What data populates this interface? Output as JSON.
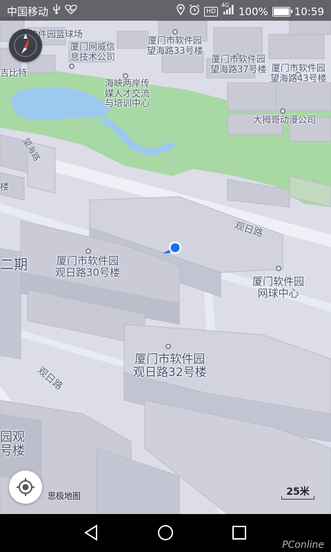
{
  "status_bar": {
    "carrier": "中国移动",
    "usb_icon": "usb-icon",
    "health_icon": "heart-pulse-icon",
    "location_icon": "location-pin-icon",
    "alarm_icon": "alarm-clock-icon",
    "hd_label": "HD",
    "network_label": "4G",
    "battery_percent": "100%",
    "battery_level": 1.0,
    "time": "10:59"
  },
  "map": {
    "background_color": "#dcdde8",
    "park_color": "#a8d8a3",
    "water_color": "#9ec9ef",
    "pois": [
      {
        "id": "softpark-basketball",
        "text": "软件园篮球场"
      },
      {
        "id": "wangwei",
        "text": "厦门网威信\n息技术公司"
      },
      {
        "id": "wanghai33",
        "text": "厦门市软件园\n望海路33号楼"
      },
      {
        "id": "wanghai37",
        "text": "厦门市软件园\n望海路37号楼"
      },
      {
        "id": "wanghai43",
        "text": "厦门市软件园\n望海路43号楼"
      },
      {
        "id": "jibiete",
        "text": "吉比特"
      },
      {
        "id": "straits-center",
        "text": "海峡两岸传\n媒人才交流\n与培训中心"
      },
      {
        "id": "damu-comics",
        "text": "大拇哥动漫公司"
      },
      {
        "id": "guanri30",
        "text": "厦门市软件园\n观日路30号楼"
      },
      {
        "id": "tennis-center",
        "text": "厦门软件园\n网球中心"
      },
      {
        "id": "guanri32",
        "text": "厦门市软件园\n观日路32号楼"
      },
      {
        "id": "phase2",
        "text": "二期"
      },
      {
        "id": "edge-guanri",
        "text": "园观\n号楼"
      },
      {
        "id": "edge-left-small",
        "text": "楼"
      }
    ],
    "roads": [
      {
        "id": "guanri-road-upper",
        "text": "观日路"
      },
      {
        "id": "guanri-road-lower",
        "text": "观日路"
      },
      {
        "id": "wanghai-road",
        "text": "望海路"
      }
    ],
    "compass_icon": "compass-icon",
    "locate_icon": "locate-crosshair-icon",
    "user_location_icon": "user-location-marker",
    "brand_label": "思极地图",
    "scale_label": "25米",
    "watermark": "PConline"
  },
  "nav_bar": {
    "back_icon": "back-triangle-icon",
    "home_icon": "home-circle-icon",
    "recents_icon": "recents-square-icon"
  }
}
